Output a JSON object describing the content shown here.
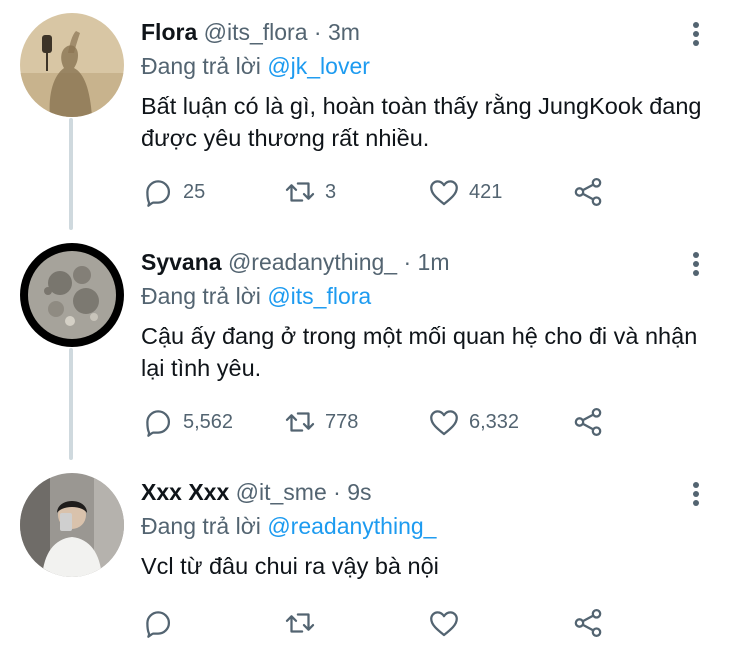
{
  "ui": {
    "reply_prefix": "Đang trả lời",
    "separator": "·"
  },
  "colors": {
    "accent": "#1d9bf0",
    "secondary": "#536471",
    "text": "#0f1419",
    "thread_line": "#cfd9de"
  },
  "tweets": [
    {
      "name": "Flora",
      "handle": "@its_flora",
      "time": "3m",
      "reply_to": "@jk_lover",
      "text": "Bất luận có là gì, hoàn toàn thấy rằng JungKook đang được yêu thương rất nhiều.",
      "replies": "25",
      "retweets": "3",
      "likes": "421",
      "avatar": "shadow-silhouette"
    },
    {
      "name": "Syvana",
      "handle": "@readanything_",
      "time": "1m",
      "reply_to": "@its_flora",
      "text": "Cậu ấy đang ở trong một mối quan hệ cho đi và nhận lại tình yêu.",
      "replies": "5,562",
      "retweets": "778",
      "likes": "6,332",
      "avatar": "full-moon"
    },
    {
      "name": "Xxx Xxx",
      "handle": "@it_sme",
      "time": "9s",
      "reply_to": "@readanything_",
      "text": "Vcl từ đâu chui ra vậy bà nội",
      "replies": "",
      "retweets": "",
      "likes": "",
      "avatar": "mirror-selfie"
    }
  ]
}
